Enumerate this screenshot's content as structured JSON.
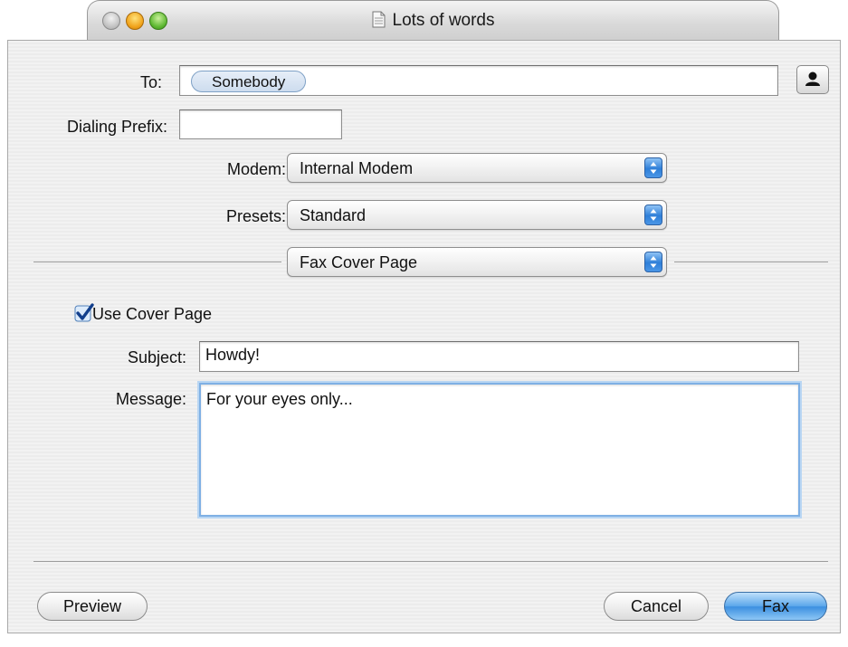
{
  "window": {
    "title": "Lots of words"
  },
  "recipient": {
    "to_label": "To:",
    "to_token": "Somebody",
    "prefix_label": "Dialing Prefix:",
    "prefix_value": ""
  },
  "modem": {
    "label": "Modem:",
    "value": "Internal Modem"
  },
  "presets": {
    "label": "Presets:",
    "value": "Standard"
  },
  "section": {
    "value": "Fax Cover Page"
  },
  "cover": {
    "checkbox_label": "Use Cover Page",
    "checked": true,
    "subject_label": "Subject:",
    "subject_value": "Howdy!",
    "message_label": "Message:",
    "message_value": "For your eyes only..."
  },
  "buttons": {
    "preview": "Preview",
    "cancel": "Cancel",
    "fax": "Fax"
  },
  "icons": {
    "address_book": "person-icon",
    "popup_arrows": "up-down-arrows-icon",
    "checkbox": "checkmark-icon"
  },
  "colors": {
    "accent": "#3b8fe0",
    "check": "#1f5fbf"
  }
}
